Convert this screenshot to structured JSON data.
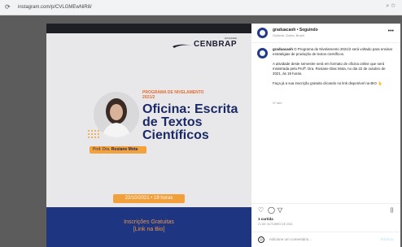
{
  "browser": {
    "url": "instagram.com/p/CVLGMEwNiR8/",
    "back_icon": "circle-arrow-icon",
    "right_icons": "⌕ ☆"
  },
  "post": {
    "brand": {
      "logo_sub": "FACULDADE",
      "logo_name": "CENBRAP"
    },
    "program_title": "PROGRAMA DE NIVELAMENTO 2021/2",
    "main_title": "Oficina: Escrita de Textos Científicos",
    "speaker_prefix": "Prof. Dra.",
    "speaker_name": "Rosiane Mota",
    "date_time": "22/10/2021 • 19 horas",
    "band_line1": "Inscrições Gratuitas",
    "band_line2": "[Link na Bio]"
  },
  "side": {
    "account": "graduacaoh • Seguindo",
    "account_sub": "Goiânia, Goiás, Brasil",
    "caption_user": "graduacaoh",
    "caption_p1": "O Programa de Nivelamento 2021/2 será voltado para ensinar estratégias de produção de textos científicos.",
    "caption_p2": "A atividade deste semestre será em formato de oficina online que será ministrada pela Profª. Dra. Rosiane Dias Mota, no dia 22 de outubro de 2021, às 19 horas.",
    "caption_p3": "Faça já a sua inscrição gratuita clicando no link disponível na BIO 👆",
    "time_ago": "37 sem",
    "likes": "1 curtida",
    "post_date": "21 DE OUTUBRO DE 2021",
    "comment_placeholder": "Adicione um comentário...",
    "publish_label": "Publicar",
    "more_label": "•••",
    "emoji_label": "☺"
  },
  "colors": {
    "navy": "#1e3582",
    "orange": "#f1a03c",
    "title": "#1b2a66"
  }
}
